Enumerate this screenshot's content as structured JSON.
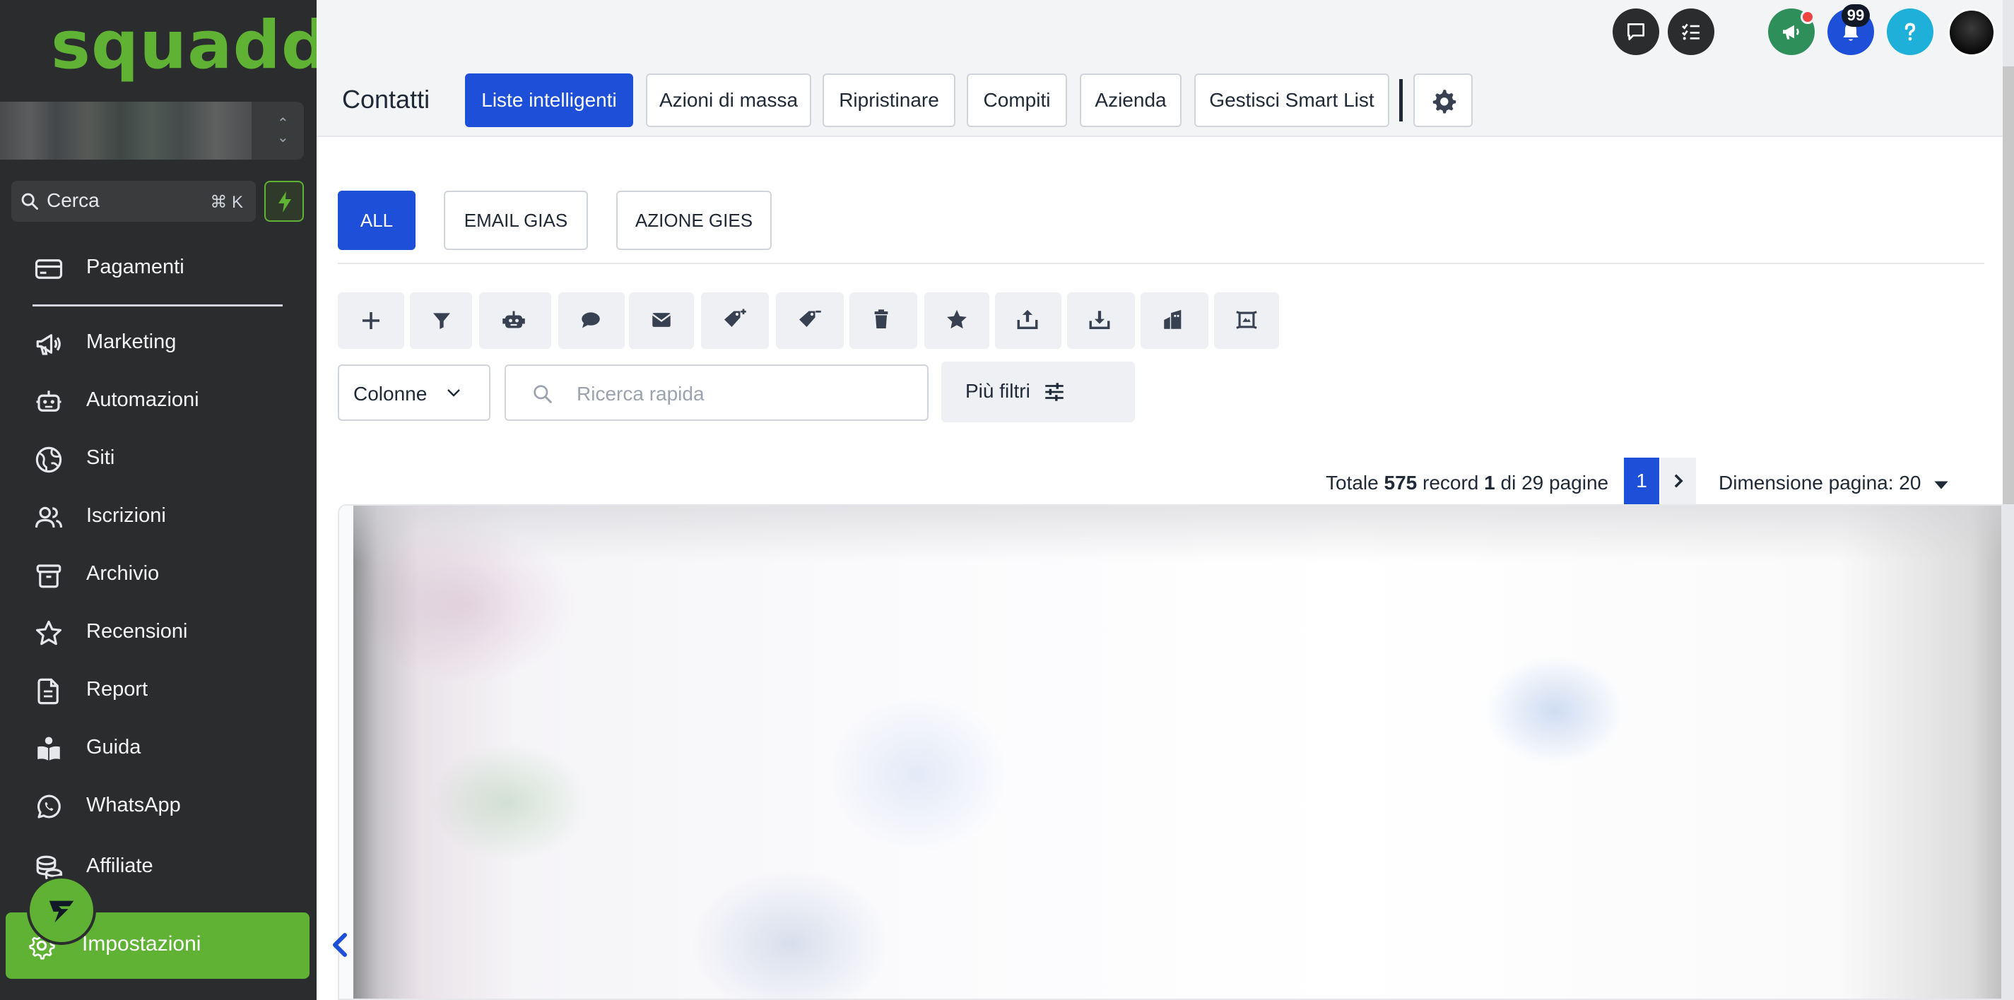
{
  "app": {
    "logo_text": "squadd",
    "brand_color": "#5fb234",
    "accent_color": "#1d4fd8"
  },
  "sidebar": {
    "search_placeholder": "Cerca",
    "search_shortcut": "⌘ K",
    "items": [
      {
        "label": "Pagamenti",
        "icon": "credit-card-icon"
      },
      {
        "label": "Marketing",
        "icon": "megaphone-icon"
      },
      {
        "label": "Automazioni",
        "icon": "robot-icon"
      },
      {
        "label": "Siti",
        "icon": "globe-icon"
      },
      {
        "label": "Iscrizioni",
        "icon": "users-icon"
      },
      {
        "label": "Archivio",
        "icon": "archive-icon"
      },
      {
        "label": "Recensioni",
        "icon": "star-icon"
      },
      {
        "label": "Report",
        "icon": "report-icon"
      },
      {
        "label": "Guida",
        "icon": "book-reader-icon"
      },
      {
        "label": "WhatsApp",
        "icon": "whatsapp-icon"
      },
      {
        "label": "Affiliate",
        "icon": "coins-icon"
      }
    ],
    "settings_label": "Impostazioni"
  },
  "topbar": {
    "notification_count": "99"
  },
  "header": {
    "title": "Contatti",
    "tabs": [
      {
        "label": "Liste intelligenti",
        "active": true
      },
      {
        "label": "Azioni di massa",
        "active": false
      },
      {
        "label": "Ripristinare",
        "active": false
      },
      {
        "label": "Compiti",
        "active": false
      },
      {
        "label": "Azienda",
        "active": false
      },
      {
        "label": "Gestisci Smart List",
        "active": false
      }
    ]
  },
  "smart_lists": [
    {
      "label": "ALL",
      "active": true
    },
    {
      "label": "EMAIL GIAS",
      "active": false
    },
    {
      "label": "AZIONE GIES",
      "active": false
    }
  ],
  "toolbar": {
    "tools": [
      "plus-icon",
      "filter-icon",
      "robot-icon",
      "chat-icon",
      "envelope-icon",
      "tag-add-icon",
      "tag-remove-icon",
      "trash-icon",
      "star-icon",
      "export-icon",
      "import-icon",
      "company-icon",
      "merge-icon"
    ],
    "columns_label": "Colonne",
    "quick_search_placeholder": "Ricerca rapida",
    "more_filters_label": "Più filtri"
  },
  "pagination": {
    "total_prefix": "Totale",
    "total_records": "575",
    "records_word": "record",
    "current_page": "1",
    "of_word": "di",
    "total_pages": "29",
    "pages_word": "pagine",
    "page_size_label": "Dimensione pagina: 20"
  }
}
